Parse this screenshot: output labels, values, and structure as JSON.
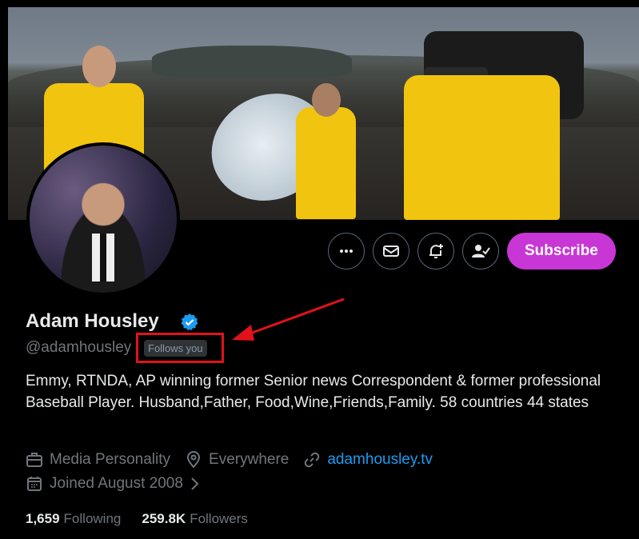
{
  "profile": {
    "name": "Adam Housley",
    "handle": "@adamhousley",
    "follows_you": "Follows you",
    "bio": "Emmy, RTNDA, AP winning former Senior news Correspondent & former professional Baseball Player. Husband,Father, Food,Wine,Friends,Family. 58 countries 44 states",
    "category": "Media Personality",
    "location": "Everywhere",
    "website": "adamhousley.tv",
    "joined": "Joined August 2008",
    "following_count": "1,659",
    "following_label": "Following",
    "followers_count": "259.8K",
    "followers_label": "Followers"
  },
  "actions": {
    "more_icon": "more-icon",
    "message_icon": "mail-icon",
    "notify_icon": "bell-plus-icon",
    "follow_icon": "person-check-icon",
    "subscribe_label": "Subscribe"
  },
  "colors": {
    "subscribe_bg": "#c936d6",
    "link": "#1d9bf0",
    "verified": "#1d9bf0",
    "highlight": "#e0121a"
  }
}
